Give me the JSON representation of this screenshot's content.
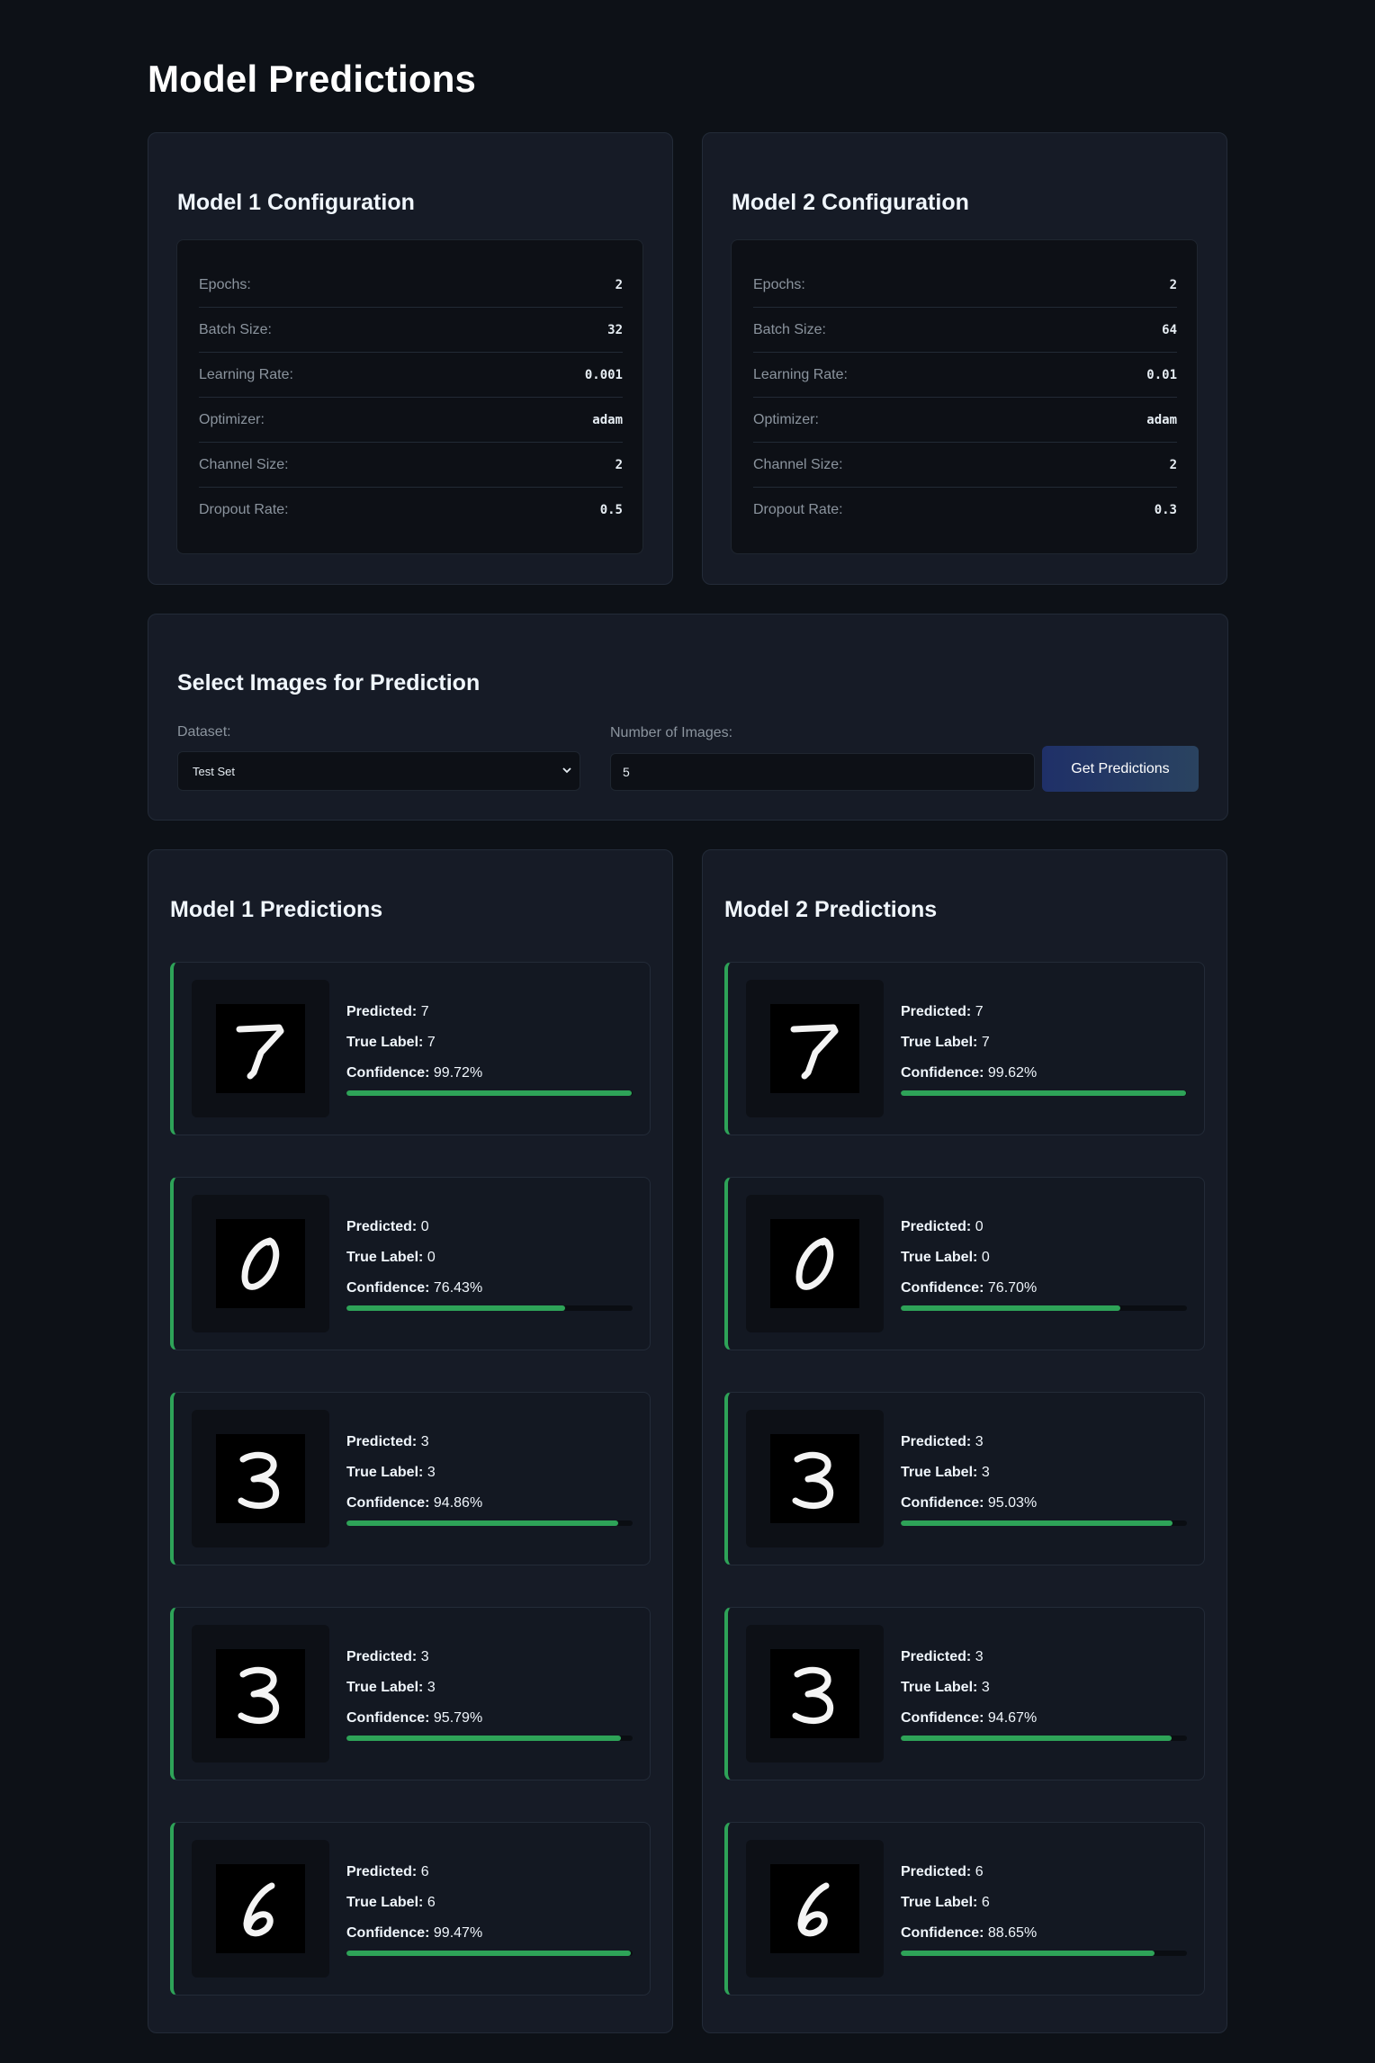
{
  "page_title": "Model Predictions",
  "config_labels": {
    "epochs": "Epochs:",
    "batch_size": "Batch Size:",
    "learning_rate": "Learning Rate:",
    "optimizer": "Optimizer:",
    "channel_size": "Channel Size:",
    "dropout_rate": "Dropout Rate:"
  },
  "models": [
    {
      "config_title": "Model 1 Configuration",
      "config": {
        "epochs": "2",
        "batch_size": "32",
        "learning_rate": "0.001",
        "optimizer": "adam",
        "channel_size": "2",
        "dropout_rate": "0.5"
      },
      "predictions_title": "Model 1 Predictions",
      "predictions": [
        {
          "predicted": "7",
          "true_label": "7",
          "confidence": "99.72%",
          "confidence_value": 0.9972
        },
        {
          "predicted": "0",
          "true_label": "0",
          "confidence": "76.43%",
          "confidence_value": 0.7643
        },
        {
          "predicted": "3",
          "true_label": "3",
          "confidence": "94.86%",
          "confidence_value": 0.9486
        },
        {
          "predicted": "3",
          "true_label": "3",
          "confidence": "95.79%",
          "confidence_value": 0.9579
        },
        {
          "predicted": "6",
          "true_label": "6",
          "confidence": "99.47%",
          "confidence_value": 0.9947
        }
      ]
    },
    {
      "config_title": "Model 2 Configuration",
      "config": {
        "epochs": "2",
        "batch_size": "64",
        "learning_rate": "0.01",
        "optimizer": "adam",
        "channel_size": "2",
        "dropout_rate": "0.3"
      },
      "predictions_title": "Model 2 Predictions",
      "predictions": [
        {
          "predicted": "7",
          "true_label": "7",
          "confidence": "99.62%",
          "confidence_value": 0.9962
        },
        {
          "predicted": "0",
          "true_label": "0",
          "confidence": "76.70%",
          "confidence_value": 0.767
        },
        {
          "predicted": "3",
          "true_label": "3",
          "confidence": "95.03%",
          "confidence_value": 0.9503
        },
        {
          "predicted": "3",
          "true_label": "3",
          "confidence": "94.67%",
          "confidence_value": 0.9467
        },
        {
          "predicted": "6",
          "true_label": "6",
          "confidence": "88.65%",
          "confidence_value": 0.8865
        }
      ]
    }
  ],
  "prediction_labels": {
    "predicted": "Predicted:",
    "true_label": "True Label:",
    "confidence": "Confidence:"
  },
  "select": {
    "title": "Select Images for Prediction",
    "dataset_label": "Dataset:",
    "dataset_value": "Test Set",
    "num_images_label": "Number of Images:",
    "num_images_value": "5",
    "button_label": "Get Predictions"
  },
  "colors": {
    "background": "#0d1117",
    "card": "#161b26",
    "accent_green": "#2ea358",
    "button": "#233468"
  }
}
